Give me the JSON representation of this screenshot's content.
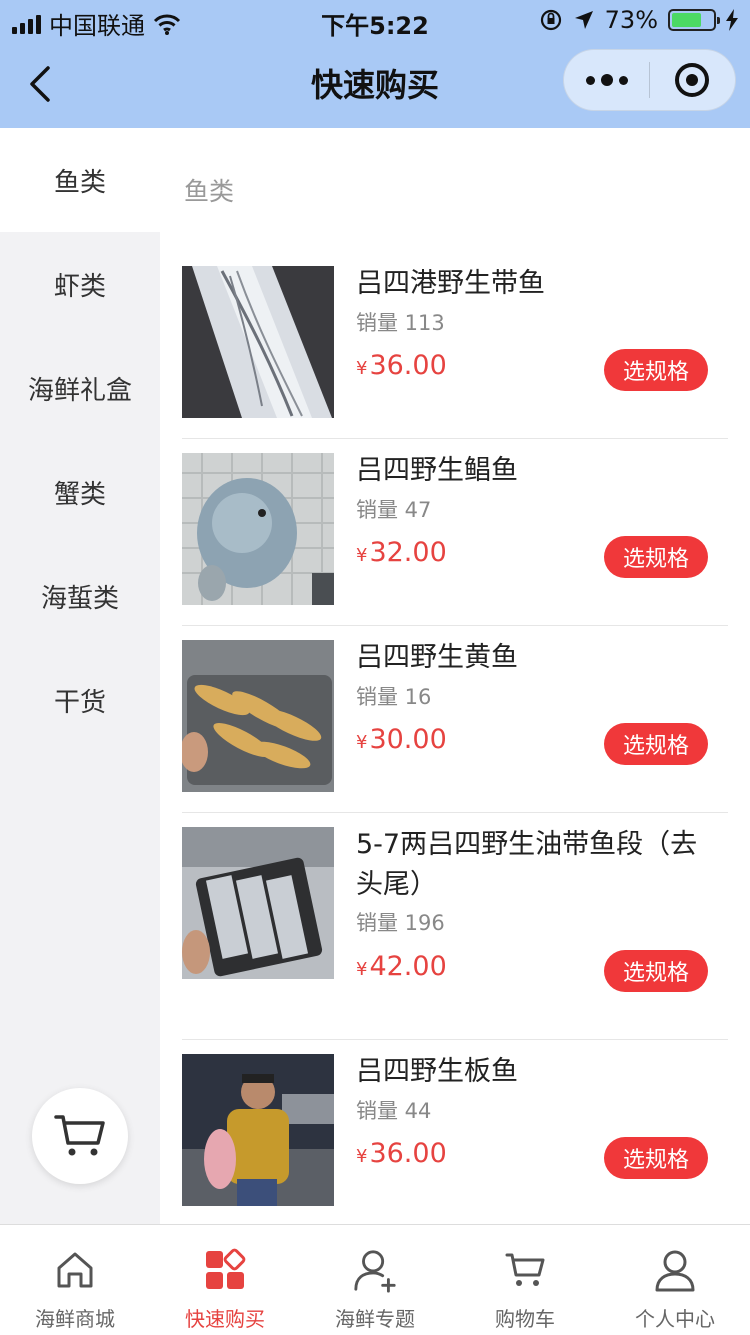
{
  "status_bar": {
    "carrier": "中国联通",
    "time": "下午5:22",
    "battery": "73%",
    "battery_level": 0.73
  },
  "nav": {
    "title": "快速购买"
  },
  "sidebar": {
    "items": [
      {
        "label": "鱼类",
        "active": true
      },
      {
        "label": "虾类"
      },
      {
        "label": "海鲜礼盒"
      },
      {
        "label": "蟹类"
      },
      {
        "label": "海蜇类"
      },
      {
        "label": "干货"
      }
    ]
  },
  "section_title": "鱼类",
  "products": [
    {
      "name": "吕四港野生带鱼",
      "sales": "销量 113",
      "currency": "¥",
      "price": "36.00",
      "button": "选规格"
    },
    {
      "name": "吕四野生鲳鱼",
      "sales": "销量 47",
      "currency": "¥",
      "price": "32.00",
      "button": "选规格"
    },
    {
      "name": "吕四野生黄鱼",
      "sales": "销量 16",
      "currency": "¥",
      "price": "30.00",
      "button": "选规格"
    },
    {
      "name": "5-7两吕四野生油带鱼段（去头尾）",
      "sales": "销量 196",
      "currency": "¥",
      "price": "42.00",
      "button": "选规格"
    },
    {
      "name": "吕四野生板鱼",
      "sales": "销量 44",
      "currency": "¥",
      "price": "36.00",
      "button": "选规格"
    }
  ],
  "tabbar": {
    "items": [
      {
        "label": "海鲜商城",
        "icon": "home-icon"
      },
      {
        "label": "快速购买",
        "icon": "quick-buy-icon",
        "active": true
      },
      {
        "label": "海鲜专题",
        "icon": "user-add-icon"
      },
      {
        "label": "购物车",
        "icon": "cart-icon"
      },
      {
        "label": "个人中心",
        "icon": "user-icon"
      }
    ]
  },
  "colors": {
    "accent": "#e64340",
    "button": "#f0383a",
    "nav_bg": "#a9c9f5"
  }
}
